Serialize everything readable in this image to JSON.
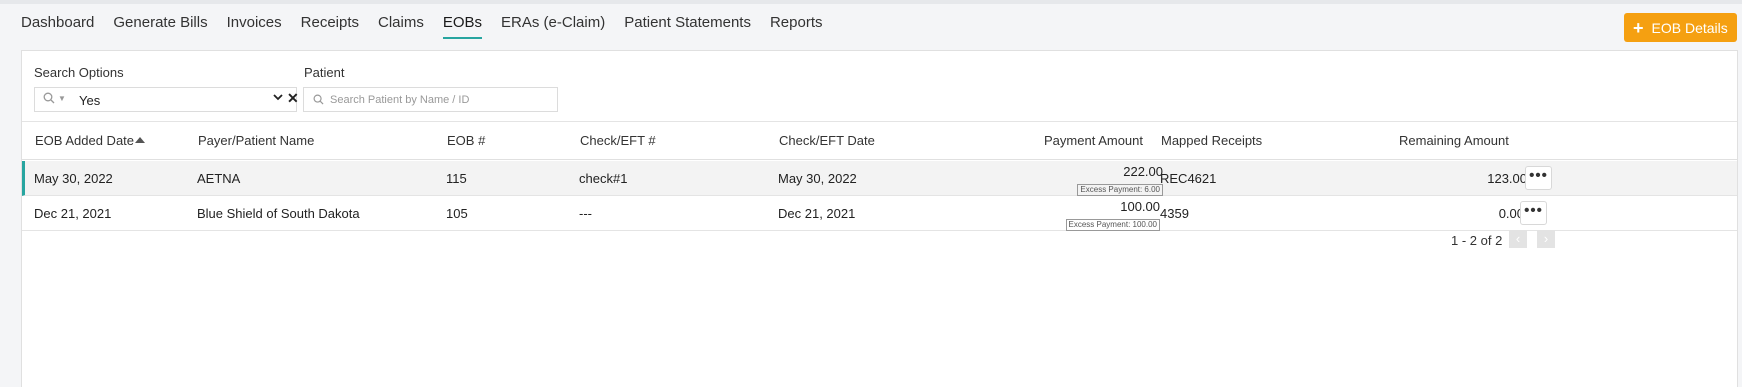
{
  "nav": {
    "tabs": [
      "Dashboard",
      "Generate Bills",
      "Invoices",
      "Receipts",
      "Claims",
      "EOBs",
      "ERAs (e-Claim)",
      "Patient Statements",
      "Reports"
    ],
    "active_index": 5,
    "action_button": "EOB Details",
    "action_icon": "plus-icon"
  },
  "filters": {
    "search_options_label": "Search Options",
    "search_options_value": "Yes",
    "patient_label": "Patient",
    "patient_placeholder": "Search Patient by Name / ID"
  },
  "table": {
    "columns": [
      "EOB Added Date",
      "Payer/Patient Name",
      "EOB #",
      "Check/EFT #",
      "Check/EFT Date",
      "Payment Amount",
      "Mapped Receipts",
      "Remaining Amount"
    ],
    "rows": [
      {
        "date": "May 30, 2022",
        "payer": "AETNA",
        "eob": "115",
        "check": "check#1",
        "check_date": "May 30, 2022",
        "payment": "222.00",
        "excess": "Excess Payment: 6.00",
        "receipts": "REC4621",
        "remaining": "123.00",
        "more": "•••"
      },
      {
        "date": "Dec 21, 2021",
        "payer": "Blue Shield of South Dakota",
        "eob": "105",
        "check": "---",
        "check_date": "Dec 21, 2021",
        "payment": "100.00",
        "excess": "Excess Payment: 100.00",
        "receipts": "4359",
        "remaining": "0.00",
        "more": "•••"
      }
    ]
  },
  "pager": {
    "text": "1 - 2 of 2",
    "prev": "‹",
    "next": "›"
  },
  "colors": {
    "accent": "#27a5a0",
    "button": "#f5a011"
  }
}
